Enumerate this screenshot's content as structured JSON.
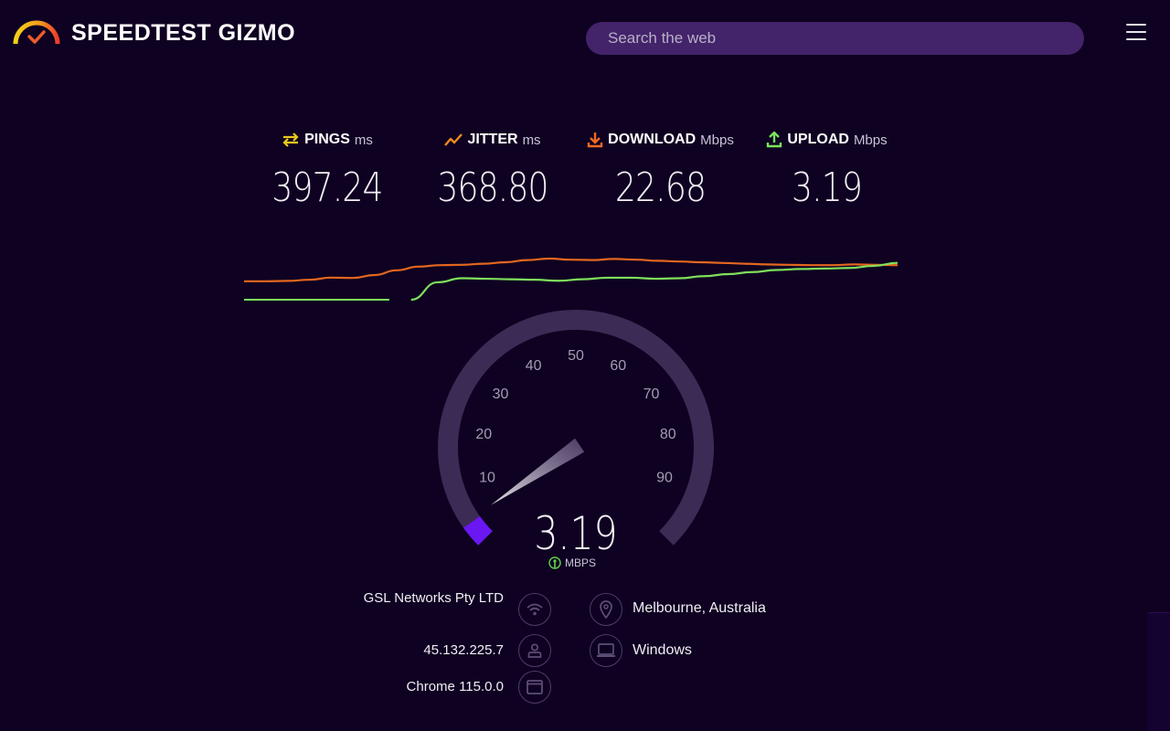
{
  "header": {
    "brand": "SPEEDTEST GIZMO",
    "search_placeholder": "Search the web",
    "menu_icon": "hamburger-menu-icon"
  },
  "metrics": [
    {
      "label": "PINGS",
      "unit": "ms",
      "value": "397.24",
      "icon": "arrows-exchange-icon",
      "color": "#e9c91d"
    },
    {
      "label": "JITTER",
      "unit": "ms",
      "value": "368.80",
      "icon": "trend-line-icon",
      "color": "#ee8a1c"
    },
    {
      "label": "DOWNLOAD",
      "unit": "Mbps",
      "value": "22.68",
      "icon": "download-icon",
      "color": "#ec6a23"
    },
    {
      "label": "UPLOAD",
      "unit": "Mbps",
      "value": "3.19",
      "icon": "upload-icon",
      "color": "#7be35a"
    }
  ],
  "graph": {
    "download_color": "#e2671f",
    "upload_color": "#7ee05b",
    "download_series": [
      0.18,
      0.18,
      0.19,
      0.22,
      0.28,
      0.27,
      0.35,
      0.48,
      0.58,
      0.62,
      0.63,
      0.66,
      0.7,
      0.76,
      0.8,
      0.77,
      0.76,
      0.79,
      0.77,
      0.74,
      0.72,
      0.7,
      0.68,
      0.66,
      0.64,
      0.63,
      0.62,
      0.62,
      0.64,
      0.63,
      0.62
    ],
    "upload_series": [
      0.0,
      0.0,
      0.0,
      0.0,
      0.0,
      0.0,
      0.0,
      null,
      0.34,
      0.42,
      0.41,
      0.4,
      0.39,
      0.37,
      0.4,
      0.43,
      0.43,
      0.41,
      0.42,
      0.46,
      0.5,
      0.54,
      0.58,
      0.6,
      0.61,
      0.62,
      0.66,
      0.72
    ]
  },
  "gauge": {
    "value": "3.19",
    "value_num": 3.19,
    "unit": "MBPS",
    "min": 0,
    "max": 100,
    "ticks": [
      "10",
      "20",
      "30",
      "40",
      "50",
      "60",
      "70",
      "80",
      "90"
    ],
    "track_color": "#3c2b55",
    "progress_color": "#6a17f2"
  },
  "client_info": {
    "isp": "GSL Networks Pty LTD",
    "ip": "45.132.225.7",
    "browser": "Chrome 115.0.0",
    "location": "Melbourne, Australia",
    "os": "Windows"
  }
}
